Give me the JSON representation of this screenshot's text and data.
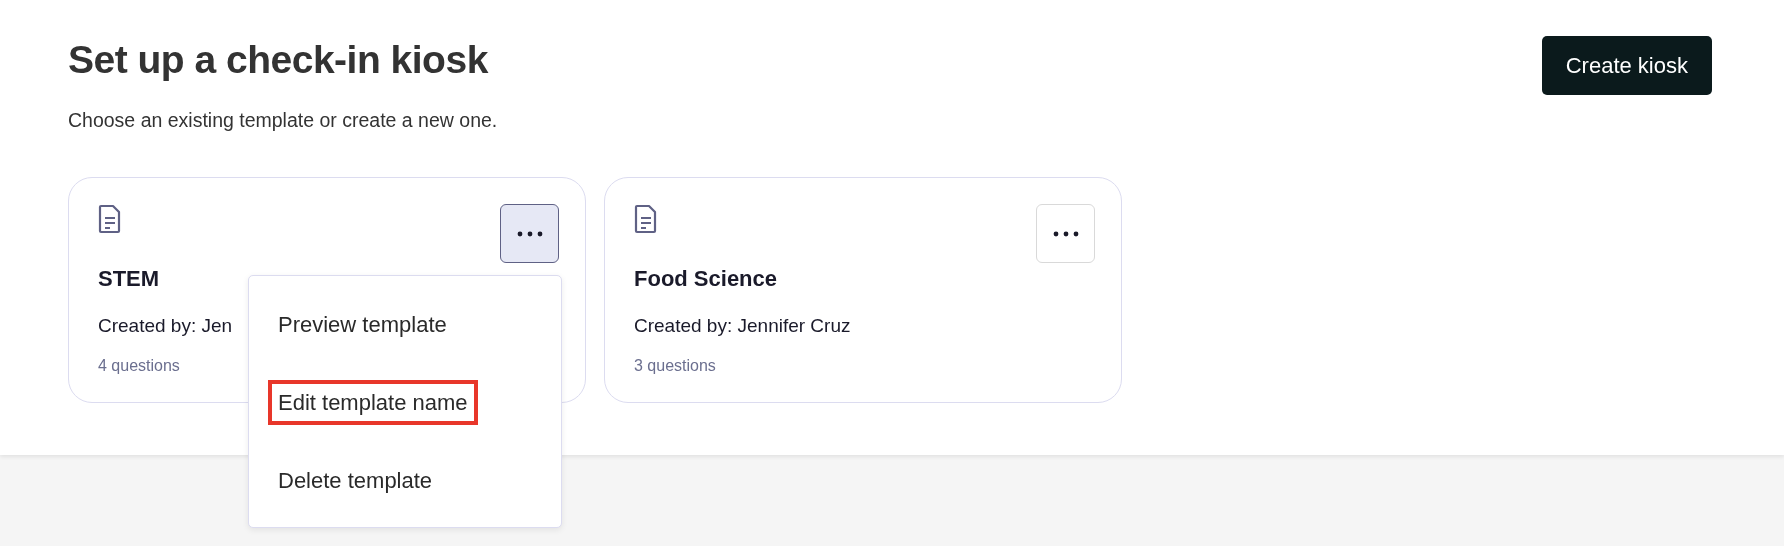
{
  "header": {
    "title": "Set up a check-in kiosk",
    "subtitle": "Choose an existing template or create a new one.",
    "button": "Create kiosk"
  },
  "templates": [
    {
      "name": "STEM",
      "created_by": "Created by: Jen",
      "questions": "4 questions",
      "menu_open": true
    },
    {
      "name": "Food Science",
      "created_by": "Created by: Jennifer Cruz",
      "questions": "3 questions",
      "menu_open": false
    }
  ],
  "menu": {
    "items": [
      {
        "label": "Preview template",
        "highlighted": false
      },
      {
        "label": "Edit template name",
        "highlighted": true
      },
      {
        "label": "Delete template",
        "highlighted": false
      }
    ]
  }
}
